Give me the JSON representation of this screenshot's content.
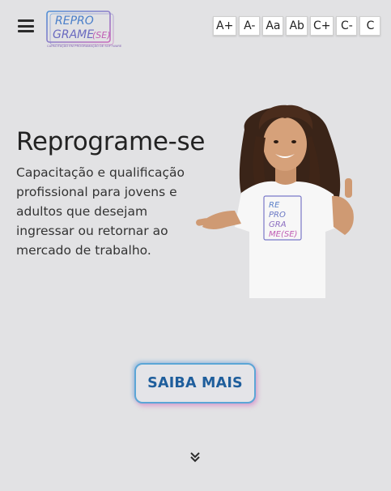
{
  "header": {
    "logo": {
      "line1": "REPRO",
      "line2": "GRAME",
      "line3": "(SE)",
      "tagline": "CAPACITAÇÃO EM PROGRAMAÇÃO DE SOFTWARE"
    },
    "accessibility": [
      "A+",
      "A-",
      "Aa",
      "Ab",
      "C+",
      "C-",
      "C"
    ]
  },
  "hero": {
    "title": "Reprograme-se",
    "description": "Capacitação e qualificação profissional para jovens e adultos que desejam ingressar ou retornar ao mercado de trabalho.",
    "shirt_print": [
      "RE",
      "PRO",
      "GRA",
      "ME(SE)"
    ]
  },
  "cta": {
    "label": "SAIBA MAIS"
  },
  "colors": {
    "background": "#e2e2e4",
    "brand_blue": "#1f5e9c",
    "brand_purple": "#7b5ab0",
    "accent_pink": "#d66ebe"
  },
  "icons": {
    "menu": "hamburger-menu-icon",
    "scroll": "double-chevron-down-icon"
  }
}
